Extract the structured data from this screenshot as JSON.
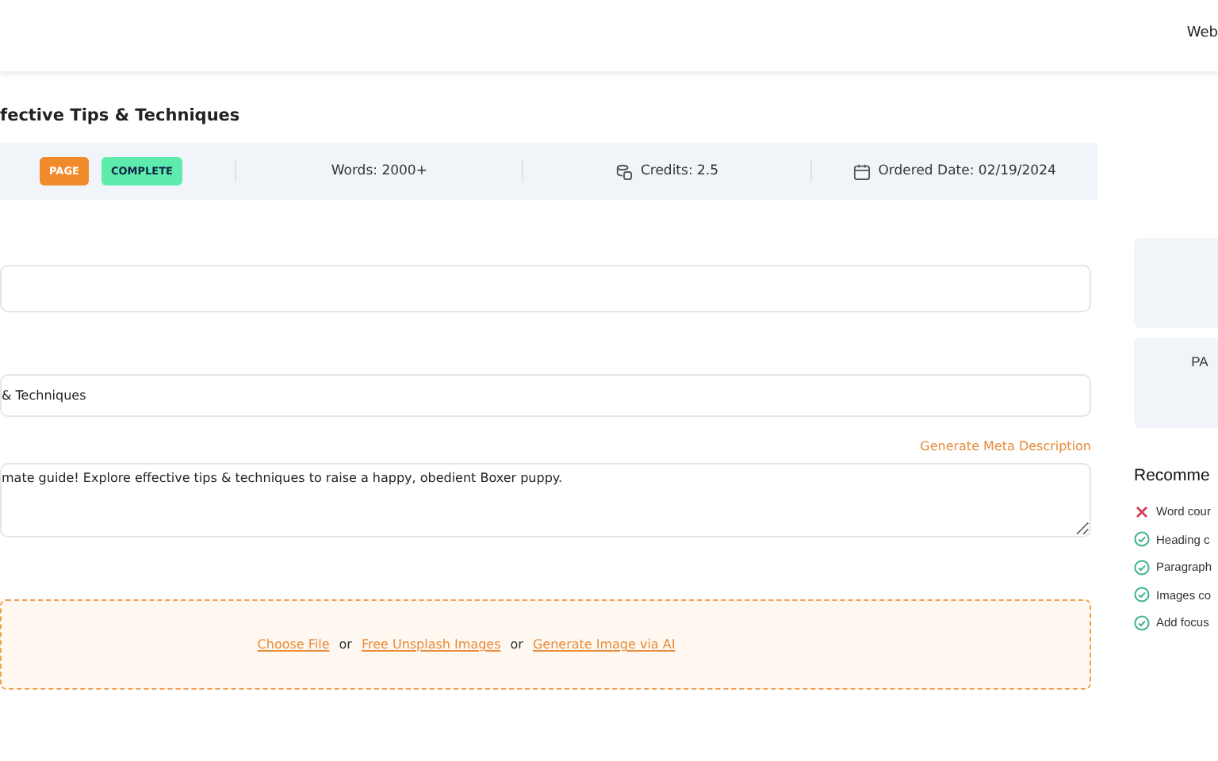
{
  "header": {
    "nav_text": "Web"
  },
  "title": "fective Tips & Techniques",
  "info_bar": {
    "badges": [
      {
        "label": "PAGE",
        "kind": "type"
      },
      {
        "label": "COMPLETE",
        "kind": "status"
      }
    ],
    "words": "Words: 2000+",
    "credits": "Credits: 2.5",
    "ordered_date": "Ordered Date: 02/19/2024"
  },
  "text_field": {
    "value": "& Techniques"
  },
  "generate_meta_link": "Generate Meta Description",
  "meta_description": "mate guide! Explore effective tips & techniques to raise a happy, obedient Boxer puppy.",
  "upload": {
    "choose_file": "Choose File",
    "or_1": "or",
    "unsplash": "Free Unsplash Images",
    "or_2": "or",
    "generate_ai": "Generate Image via AI"
  },
  "side_card": {
    "text": "PA"
  },
  "recommendations": {
    "heading": "Recomme",
    "items": [
      {
        "text": "Word cour",
        "passed": false
      },
      {
        "text": "Heading c",
        "passed": true
      },
      {
        "text": "Paragraph",
        "passed": true
      },
      {
        "text": "Images co",
        "passed": true
      },
      {
        "text": "Add focus",
        "passed": true
      }
    ]
  }
}
